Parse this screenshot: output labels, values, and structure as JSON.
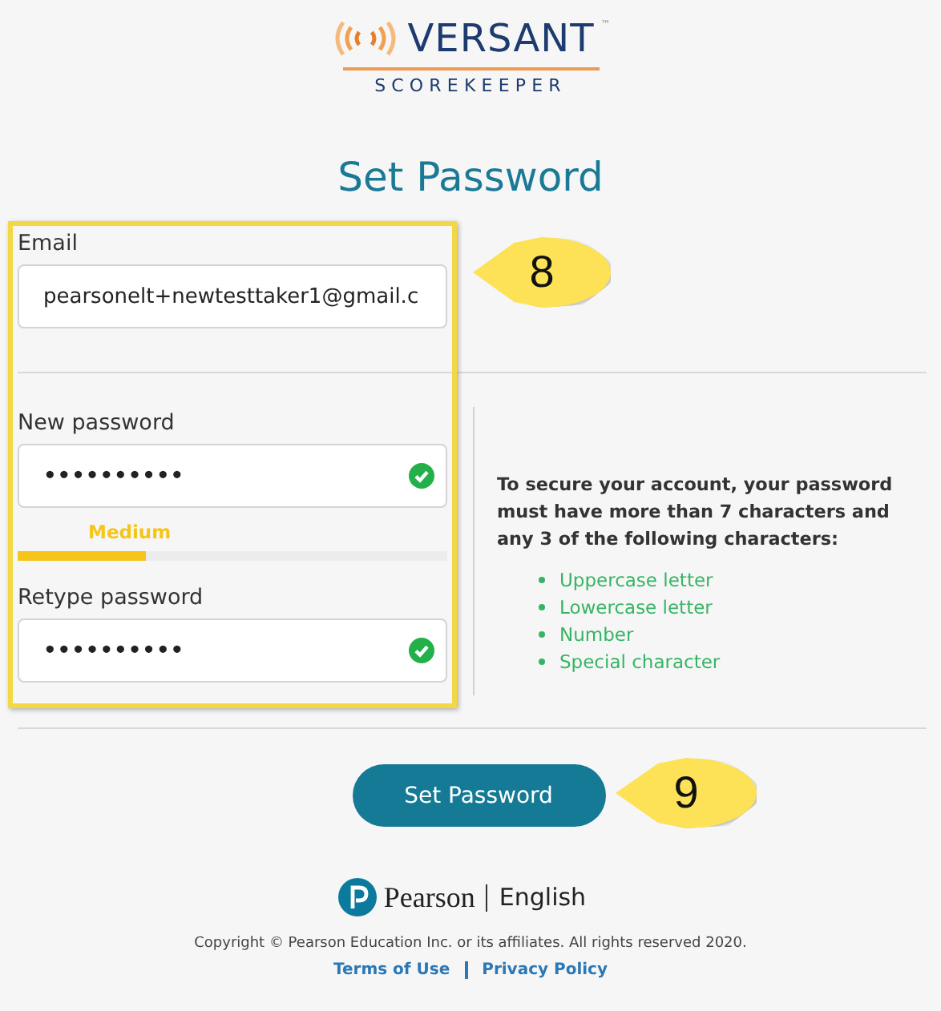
{
  "logo": {
    "brand": "VERSANT",
    "trademark": "™",
    "product": "SCOREKEEPER"
  },
  "title": "Set Password",
  "email": {
    "label": "Email",
    "value": "pearsonelt+newtesttaker1@gmail.c"
  },
  "passwords": [
    {
      "label": "New password",
      "value": "••••••••••",
      "valid": true
    },
    {
      "label": "Retype password",
      "value": "••••••••••",
      "valid": true
    }
  ],
  "strength": {
    "label": "Medium",
    "level": 0.3
  },
  "rules": {
    "intro": "To secure your account, your password must have more than 7 characters and any 3 of the following characters:",
    "items": [
      "Uppercase letter",
      "Lowercase letter",
      "Number",
      "Special character"
    ]
  },
  "button": "Set Password",
  "callouts": [
    {
      "number": "8"
    },
    {
      "number": "9"
    }
  ],
  "footer": {
    "brand": "Pearson",
    "language": "English",
    "copyright": "Copyright © Pearson Education Inc. or its affiliates. All rights reserved 2020.",
    "links": [
      "Terms of Use",
      "Privacy Policy"
    ]
  }
}
